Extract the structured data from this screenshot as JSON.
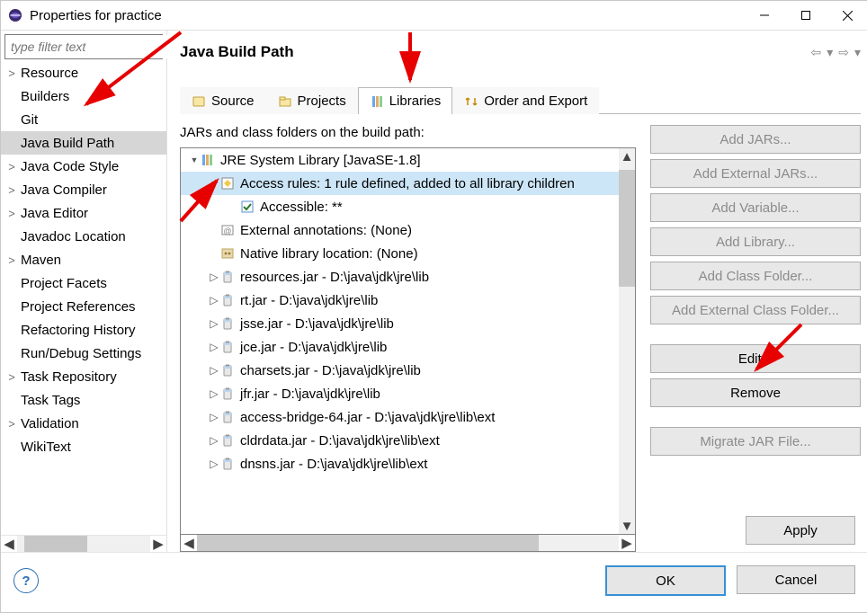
{
  "window": {
    "title": "Properties for practice"
  },
  "sidebar": {
    "filter_placeholder": "type filter text",
    "items": [
      {
        "label": "Resource",
        "caret": ">"
      },
      {
        "label": "Builders",
        "caret": ""
      },
      {
        "label": "Git",
        "caret": ""
      },
      {
        "label": "Java Build Path",
        "caret": "",
        "selected": true
      },
      {
        "label": "Java Code Style",
        "caret": ">"
      },
      {
        "label": "Java Compiler",
        "caret": ">"
      },
      {
        "label": "Java Editor",
        "caret": ">"
      },
      {
        "label": "Javadoc Location",
        "caret": ""
      },
      {
        "label": "Maven",
        "caret": ">"
      },
      {
        "label": "Project Facets",
        "caret": ""
      },
      {
        "label": "Project References",
        "caret": ""
      },
      {
        "label": "Refactoring History",
        "caret": ""
      },
      {
        "label": "Run/Debug Settings",
        "caret": ""
      },
      {
        "label": "Task Repository",
        "caret": ">"
      },
      {
        "label": "Task Tags",
        "caret": ""
      },
      {
        "label": "Validation",
        "caret": ">"
      },
      {
        "label": "WikiText",
        "caret": ""
      }
    ]
  },
  "page": {
    "heading": "Java Build Path",
    "caption": "JARs and class folders on the build path:"
  },
  "tabs": [
    {
      "label": "Source"
    },
    {
      "label": "Projects"
    },
    {
      "label": "Libraries",
      "active": true
    },
    {
      "label": "Order and Export"
    }
  ],
  "tree": [
    {
      "indent": 0,
      "caret": "v",
      "label": "JRE System Library [JavaSE-1.8]",
      "icon": "library"
    },
    {
      "indent": 1,
      "caret": "v",
      "label": "Access rules: 1 rule defined, added to all library children",
      "icon": "access",
      "selected": true
    },
    {
      "indent": 2,
      "caret": "",
      "label": "Accessible: **",
      "icon": "check"
    },
    {
      "indent": 1,
      "caret": "",
      "label": "External annotations: (None)",
      "icon": "ext"
    },
    {
      "indent": 1,
      "caret": "",
      "label": "Native library location: (None)",
      "icon": "native"
    },
    {
      "indent": 1,
      "caret": ">",
      "label": "resources.jar - D:\\java\\jdk\\jre\\lib",
      "icon": "jar"
    },
    {
      "indent": 1,
      "caret": ">",
      "label": "rt.jar - D:\\java\\jdk\\jre\\lib",
      "icon": "jar"
    },
    {
      "indent": 1,
      "caret": ">",
      "label": "jsse.jar - D:\\java\\jdk\\jre\\lib",
      "icon": "jar"
    },
    {
      "indent": 1,
      "caret": ">",
      "label": "jce.jar - D:\\java\\jdk\\jre\\lib",
      "icon": "jar"
    },
    {
      "indent": 1,
      "caret": ">",
      "label": "charsets.jar - D:\\java\\jdk\\jre\\lib",
      "icon": "jar"
    },
    {
      "indent": 1,
      "caret": ">",
      "label": "jfr.jar - D:\\java\\jdk\\jre\\lib",
      "icon": "jar"
    },
    {
      "indent": 1,
      "caret": ">",
      "label": "access-bridge-64.jar - D:\\java\\jdk\\jre\\lib\\ext",
      "icon": "jar"
    },
    {
      "indent": 1,
      "caret": ">",
      "label": "cldrdata.jar - D:\\java\\jdk\\jre\\lib\\ext",
      "icon": "jar"
    },
    {
      "indent": 1,
      "caret": ">",
      "label": "dnsns.jar - D:\\java\\jdk\\jre\\lib\\ext",
      "icon": "jar"
    }
  ],
  "buttons": {
    "add_jars": "Add JARs...",
    "add_ext_jars": "Add External JARs...",
    "add_variable": "Add Variable...",
    "add_library": "Add Library...",
    "add_class_folder": "Add Class Folder...",
    "add_ext_class_folder": "Add External Class Folder...",
    "edit": "Edit...",
    "remove": "Remove",
    "migrate": "Migrate JAR File...",
    "apply": "Apply",
    "ok": "OK",
    "cancel": "Cancel"
  }
}
